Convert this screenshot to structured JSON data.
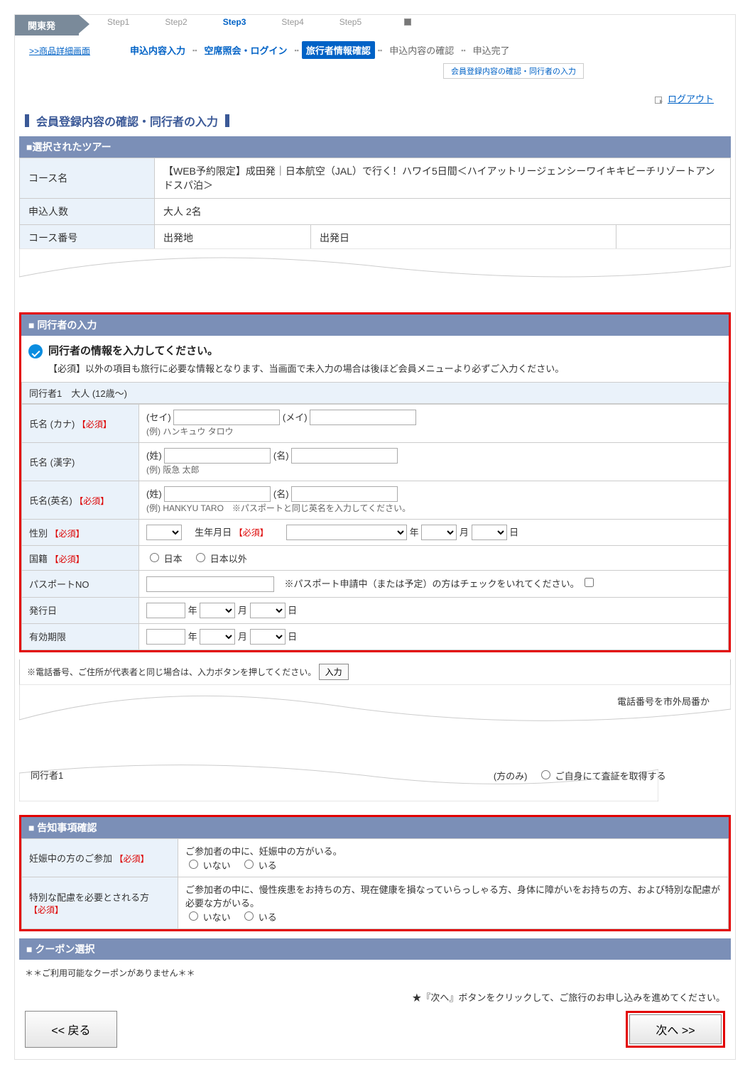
{
  "header": {
    "origin": "関東発",
    "back_link": ">>商品詳細画面",
    "steps": [
      "Step1",
      "Step2",
      "Step3",
      "Step4",
      "Step5"
    ],
    "active_step_index": 2,
    "substeps": {
      "s1": "申込内容入力",
      "s2": "空席照会・ログイン",
      "s3": "旅行者情報確認",
      "s4": "申込内容の確認",
      "s5": "申込完了"
    },
    "sub_tab": "会員登録内容の確認・同行者の入力",
    "logout": "ログアウト"
  },
  "h2": "会員登録内容の確認・同行者の入力",
  "tour": {
    "section_title": "■選択されたツアー",
    "rows": {
      "course_label": "コース名",
      "course_value": "【WEB予約限定】成田発｜日本航空（JAL）で行く！ハワイ5日間＜ハイアットリージェンシーワイキキビーチリゾートアンドスパ泊＞",
      "pax_label": "申込人数",
      "pax_value": "大人 2名",
      "courseno_label": "コース番号",
      "depart_label": "出発地",
      "depart2_label": "出発日"
    }
  },
  "companion": {
    "section_title": "■ 同行者の入力",
    "info_title": "同行者の情報を入力してください。",
    "info_sub": "【必須】以外の項目も旅行に必要な情報となります、当画面で未入力の場合は後ほど会員メニューより必ずご入力ください。",
    "subhead": "同行者1　大人 (12歳～)",
    "labels": {
      "kana": "氏名 (カナ)",
      "kanji": "氏名 (漢字)",
      "roman": "氏名(英名)",
      "sei_lbl": "(セイ)",
      "mei_lbl": "(メイ)",
      "last_lbl": "(姓)",
      "first_lbl": "(名)",
      "gender": "性別",
      "dob": "生年月日",
      "year": "年",
      "month": "月",
      "day": "日",
      "nationality": "国籍",
      "jp": "日本",
      "nonjp": "日本以外",
      "passport": "パスポートNO",
      "issue": "発行日",
      "expiry": "有効期限",
      "req": "【必須】",
      "kana_ex": "(例) ハンキュウ タロウ",
      "kanji_ex": "(例) 阪急 太郎",
      "roman_ex": "(例) HANKYU TARO　※パスポートと同じ英名を入力してください。",
      "passport_note": "※パスポート申請中（または予定）の方はチェックをいれてください。"
    },
    "input_note": "※電話番号、ご住所が代表者と同じ場合は、入力ボタンを押してください。",
    "input_btn": "入力",
    "torn_text": "電話番号を市外局番か",
    "row2_left": "同行者1",
    "row2_mid": "(方のみ)",
    "row2_right": "ご自身にて査証を取得する"
  },
  "disclosure": {
    "section_title": "■ 告知事項確認",
    "preg_label": "妊娠中の方のご参加",
    "preg_text": "ご参加者の中に、妊娠中の方がいる。",
    "sp_label": "特別な配慮を必要とされる方",
    "sp_text": "ご参加者の中に、慢性疾患をお持ちの方、現在健康を損なっていらっしゃる方、身体に障がいをお持ちの方、および特別な配慮が必要な方がいる。",
    "opt_no": "いない",
    "opt_yes": "いる",
    "req": "【必須】"
  },
  "coupon": {
    "section_title": "■ クーポン選択",
    "none_text": "＊＊ご利用可能なクーポンがありません＊＊"
  },
  "footer": {
    "note": "★『次へ』ボタンをクリックして、ご旅行のお申し込みを進めてください。",
    "back": "<< 戻る",
    "next": "次へ >>"
  }
}
